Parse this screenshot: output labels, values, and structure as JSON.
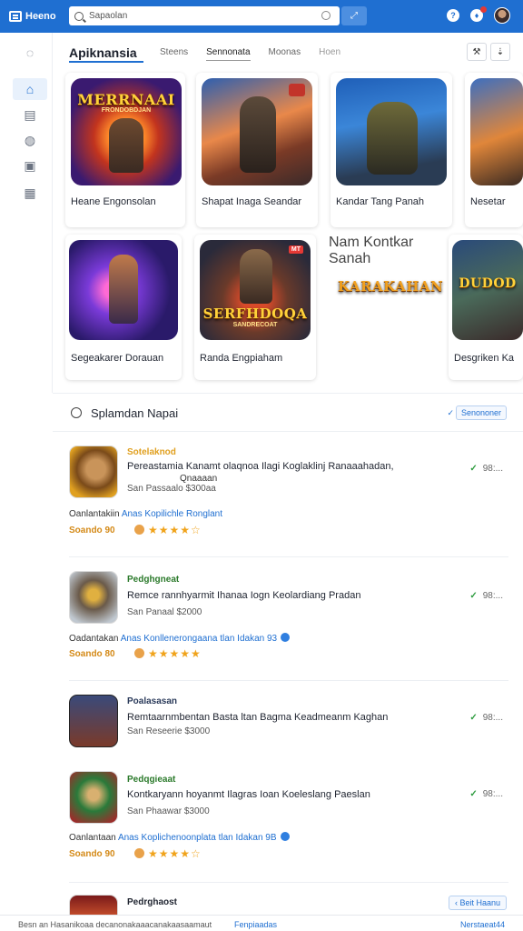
{
  "app": {
    "brand": "Heeno"
  },
  "search": {
    "value": "Sapaolan",
    "button_icon": "arrows-icon"
  },
  "header": {
    "title": "Apiknansia",
    "tabs": [
      "Steens",
      "Sennonata",
      "Moonas",
      "Hoen"
    ],
    "active_tab": 1
  },
  "sidebar": {
    "items": [
      {
        "icon": "chat-icon",
        "active": false
      },
      {
        "icon": "home-icon",
        "active": true
      },
      {
        "icon": "list-icon",
        "active": false
      },
      {
        "icon": "store-icon",
        "active": false
      },
      {
        "icon": "book-icon",
        "active": false
      },
      {
        "icon": "gamepad-icon",
        "active": false
      }
    ]
  },
  "featured": [
    {
      "name": "Heane Engonsolan",
      "logo": "MERRNAAI",
      "logo_sub": "FRONDOBDJAN",
      "badge": ""
    },
    {
      "name": "Shapat Inaga Seandar",
      "logo": "",
      "logo_sub": "",
      "badge": ""
    },
    {
      "name": "Kandar Tang Panah",
      "logo": "",
      "logo_sub": "",
      "badge": ""
    },
    {
      "name": "Nesetar",
      "logo": "",
      "logo_sub": "",
      "badge": ""
    },
    {
      "name": "Segeakarer Dorauan",
      "logo": "",
      "logo_sub": "",
      "badge": ""
    },
    {
      "name": "Randa Engpiaham",
      "logo": "SERFHDOQA",
      "logo_sub": "SANDRECOAT",
      "badge": "MT"
    },
    {
      "name": "Nam Kontkar Sanah",
      "logo": "KARAKAHAN",
      "logo_sub": "",
      "badge": ""
    },
    {
      "name": "Desgriken Ka",
      "logo": "DUDOD",
      "logo_sub": "",
      "badge": ""
    }
  ],
  "section": {
    "title": "Splamdan Napai",
    "action": "Senononer"
  },
  "list": [
    {
      "tag": "Sotelaknod",
      "desc": "Pereastamia Kanamt olaqnoa Ilagi Koglaklinj Ranaaahadan,",
      "desc2": "Qnaaaan",
      "meta": "San Passaalo $300aa",
      "link_prefix": "Oanlantakiin",
      "link": "Anas Kopilichle Ronglant",
      "price": "Soando 90",
      "stars": "★★★★☆",
      "right": "98:..."
    },
    {
      "tag": "Pedghgneat",
      "desc": "Remce rannhyarmit Ihanaa Iogn Keolardiang Pradan",
      "desc2": "",
      "meta": "San Panaal $2000",
      "link_prefix": "Oadantakan",
      "link": "Anas Konllenerongaana tlan Idakan 93",
      "price": "Soando 80",
      "stars": "★★★★★",
      "right": "98:..."
    },
    {
      "tag": "Poalasasan",
      "desc": "Remtaarnmbentan Basta ltan Bagma Keadmeanm Kaghan",
      "desc2": "",
      "meta": "San Reseerie $3000",
      "link_prefix": "",
      "link": "",
      "price": "",
      "stars": "",
      "right": "98:..."
    },
    {
      "tag": "Pedqgieaat",
      "desc": "Kontkaryann hoyanmt Ilagras Ioan Koeleslang Paeslan",
      "desc2": "",
      "meta": "San Phaawar $3000",
      "link_prefix": "Oanlantaan",
      "link": "Anas Koplichenoonplata tlan Idakan 9B",
      "price": "Soando 90",
      "stars": "★★★★☆",
      "right": "98:..."
    },
    {
      "tag": "Pedrghaost",
      "desc": "",
      "desc2": "",
      "meta": "",
      "link_prefix": "",
      "link": "",
      "price": "",
      "stars": "",
      "right": ""
    }
  ],
  "bottom_action": "Beit Haanu",
  "footer": {
    "left": "Besn an Hasanikoaa decanonakaaacanakaasaamaut",
    "middle": "Fenpiaadas",
    "right": "Nerstaeat44"
  },
  "colors": {
    "primary": "#1f6fd1",
    "accent_green": "#2e9c3f",
    "star": "#f0a31b"
  }
}
